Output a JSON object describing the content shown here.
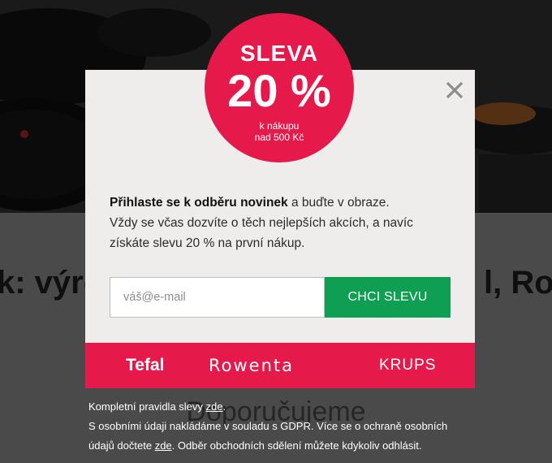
{
  "background": {
    "heading_left": "k: výro",
    "heading_right": "l, Row",
    "subheading": "Doporučujeme"
  },
  "popup": {
    "badge": {
      "title": "SLEVA",
      "percent": "20 %",
      "condition_line1": "k nákupu",
      "condition_line2": "nad 500 Kč"
    },
    "intro": {
      "bold": "Přihlaste se k odběru novinek",
      "rest": " a buďte v obraze.",
      "line2": "Vždy se včas dozvíte o těch nejlepších akcích, a navíc",
      "line3": "získáte slevu 20 % na první nákup."
    },
    "email": {
      "value": "",
      "placeholder": "váš@e-mail"
    },
    "cta_label": "CHCI SLEVU",
    "brands": [
      "Tefal",
      "Rowenta",
      "KRUPS"
    ],
    "legal": {
      "line1_text": "Kompletní pravidla slevy ",
      "link": "zde",
      "line1_end": ".",
      "line2": "S osobními údaji nakládáme v souladu s GDPR. Více se o ochraně osobních",
      "line3_text": "údajů dočtete ",
      "line3_end": ". Odběr obchodních sdělení můžete kdykoliv odhlásit."
    }
  },
  "colors": {
    "accent": "#e5194a",
    "cta": "#0f9f52",
    "modal_bg": "#eeedeb"
  },
  "icons": {
    "close": "close-icon"
  }
}
